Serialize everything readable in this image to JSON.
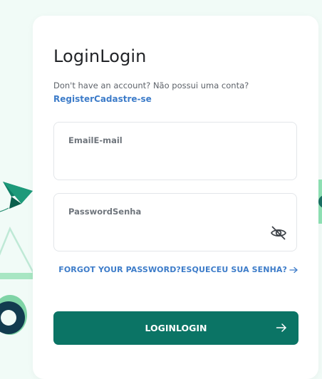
{
  "login": {
    "title": "LoginLogin",
    "prompt": "Don't have an account? Não possui uma conta?",
    "register_link": "RegisterCadastre-se",
    "email_label": "EmailE-mail",
    "email_value": "",
    "password_label": "PasswordSenha",
    "password_value": "",
    "toggle_icon": "eye-off-icon",
    "forgot_link": "FORGOT YOUR PASSWORD?ESQUECEU SUA SENHA?",
    "forgot_icon": "arrow-right-icon",
    "login_button": "LOGINLOGIN",
    "login_button_icon": "arrow-right-icon"
  },
  "colors": {
    "background": "#f1fbf7",
    "primary": "#0b7465",
    "link": "#3d7cc9",
    "card": "#ffffff"
  }
}
